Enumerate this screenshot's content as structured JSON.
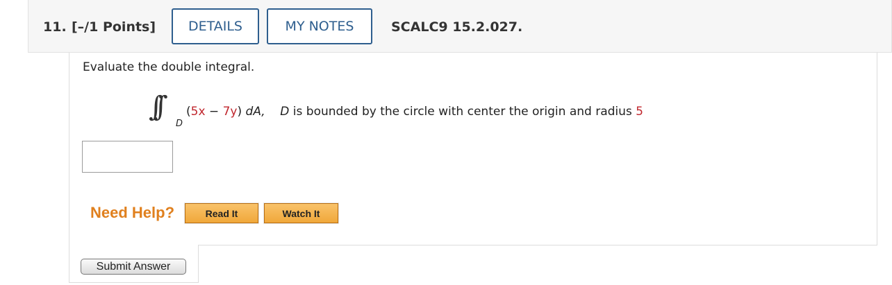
{
  "header": {
    "question_number": "11.",
    "points": "[–/1 Points]",
    "details_label": "DETAILS",
    "notes_label": "MY NOTES",
    "reference": "SCALC9 15.2.027."
  },
  "question": {
    "prompt": "Evaluate the double integral.",
    "integral_symbol": "∫∫",
    "region_subscript": "D",
    "expr_open": "(",
    "coef_x": "5x",
    "minus": " − ",
    "coef_y": "7y",
    "expr_close": ") ",
    "dA": "dA,",
    "region_letter": "D",
    "region_text": " is bounded by the circle with center the origin and radius ",
    "radius": "5"
  },
  "answer": {
    "value": ""
  },
  "help": {
    "label": "Need Help?",
    "read_label": "Read It",
    "watch_label": "Watch It"
  },
  "submit": {
    "label": "Submit Answer"
  },
  "colors": {
    "highlight": "#c0262d",
    "help": "#e0801e",
    "link_blue": "#2e5e8e"
  }
}
